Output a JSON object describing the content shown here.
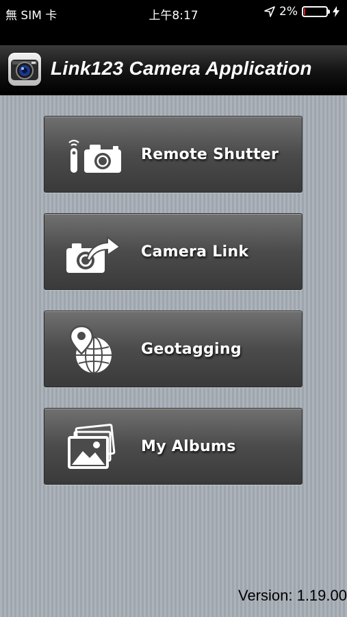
{
  "status_bar": {
    "carrier": "無 SIM 卡",
    "time": "上午8:17",
    "battery_percent": "2%",
    "battery_level": 0.02,
    "icons": [
      "location-arrow-icon",
      "battery-icon",
      "charging-bolt-icon"
    ]
  },
  "header": {
    "title": "Link123 Camera Application",
    "logo_icon": "camera-lens-logo-icon"
  },
  "menu": [
    {
      "label": "Remote Shutter",
      "icon": "remote-shutter-icon"
    },
    {
      "label": "Camera Link",
      "icon": "camera-share-icon"
    },
    {
      "label": "Geotagging",
      "icon": "globe-pin-icon"
    },
    {
      "label": "My Albums",
      "icon": "photo-albums-icon"
    }
  ],
  "footer": {
    "version": "Version: 1.19.00"
  },
  "colors": {
    "background": "#a4abb3",
    "button": "#4b4b4b",
    "header": "#121212",
    "battery_low": "#e02020"
  }
}
